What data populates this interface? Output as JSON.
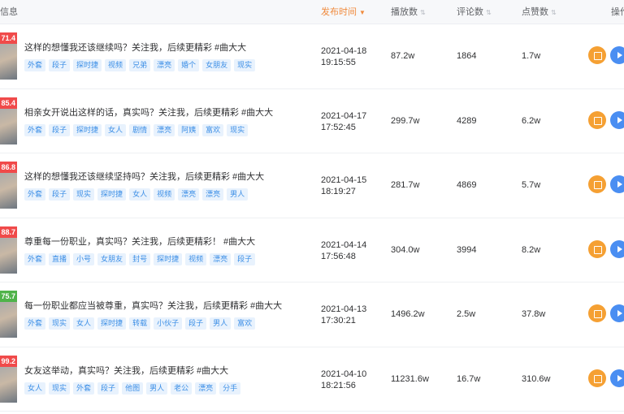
{
  "header": {
    "info": "信息",
    "publish_time": "发布时间",
    "plays": "播放数",
    "comments": "评论数",
    "likes": "点赞数",
    "actions": "操作"
  },
  "colors": {
    "accent": "#f08a3c",
    "tag_text": "#3d8fe6",
    "tag_bg": "#e8f2fd",
    "btn_orange": "#f5a033",
    "btn_blue": "#4a8ef2"
  },
  "rows": [
    {
      "score": "71.4",
      "score_color": "red",
      "title": "这样的想懂我还该继续吗？关注我，后续更精彩 #曲大大",
      "tags": [
        "外套",
        "段子",
        "探时捷",
        "视频",
        "兄弟",
        "漂亮",
        "婚个",
        "女朋友",
        "现实"
      ],
      "date": "2021-04-18",
      "time": "19:15:55",
      "plays": "87.2w",
      "comments": "1864",
      "likes": "1.7w"
    },
    {
      "score": "85.4",
      "score_color": "red",
      "title": "相亲女开说出这样的话，真实吗？关注我，后续更精彩 #曲大大",
      "tags": [
        "外套",
        "段子",
        "探时捷",
        "女人",
        "剧情",
        "漂亮",
        "阿姨",
        "富欢",
        "现实"
      ],
      "date": "2021-04-17",
      "time": "17:52:45",
      "plays": "299.7w",
      "comments": "4289",
      "likes": "6.2w"
    },
    {
      "score": "86.8",
      "score_color": "red",
      "title": "这样的想懂我还该继续坚持吗？关注我，后续更精彩 #曲大大",
      "tags": [
        "外套",
        "段子",
        "现实",
        "探时捷",
        "女人",
        "视频",
        "漂亮",
        "漂亮",
        "男人"
      ],
      "date": "2021-04-15",
      "time": "18:19:27",
      "plays": "281.7w",
      "comments": "4869",
      "likes": "5.7w"
    },
    {
      "score": "88.7",
      "score_color": "red",
      "title": "尊重每一份职业，真实吗？关注我，后续更精彩！ #曲大大",
      "tags": [
        "外套",
        "直播",
        "小号",
        "女朋友",
        "封号",
        "探时捷",
        "视频",
        "漂亮",
        "段子"
      ],
      "date": "2021-04-14",
      "time": "17:56:48",
      "plays": "304.0w",
      "comments": "3994",
      "likes": "8.2w"
    },
    {
      "score": "75.7",
      "score_color": "green",
      "title": "每一份职业都应当被尊重，真实吗？关注我，后续更精彩 #曲大大",
      "tags": [
        "外套",
        "现实",
        "女人",
        "探时捷",
        "转载",
        "小伙子",
        "段子",
        "男人",
        "富欢"
      ],
      "date": "2021-04-13",
      "time": "17:30:21",
      "plays": "1496.2w",
      "comments": "2.5w",
      "likes": "37.8w"
    },
    {
      "score": "99.2",
      "score_color": "red",
      "title": "女友这举动，真实吗？关注我，后续更精彩 #曲大大",
      "tags": [
        "女人",
        "现实",
        "外套",
        "段子",
        "他图",
        "男人",
        "老公",
        "漂亮",
        "分手"
      ],
      "date": "2021-04-10",
      "time": "18:21:56",
      "plays": "11231.6w",
      "comments": "16.7w",
      "likes": "310.6w"
    }
  ]
}
